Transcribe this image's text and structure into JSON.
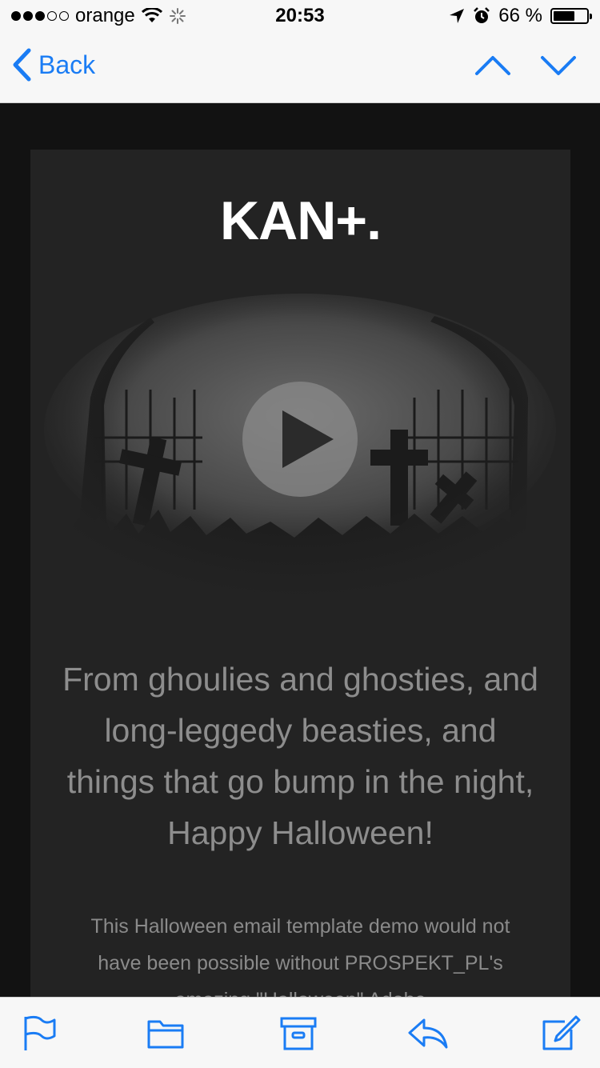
{
  "status_bar": {
    "carrier": "orange",
    "time": "20:53",
    "battery_percent": "66 %",
    "battery_level": 0.66
  },
  "nav": {
    "back_label": "Back"
  },
  "email": {
    "logo_text": "KAN+.",
    "headline": "From ghoulies and ghosties, and long-leggedy beasties, and things that go bump in the night, Happy Halloween!",
    "body": "This Halloween email template demo would not have been possible without PROSPEKT_PL's amazing \"Halloween\" Adobe"
  },
  "icons": {
    "signal": "signal-dots-icon",
    "wifi": "wifi-icon",
    "activity": "activity-spinner-icon",
    "location": "location-arrow-icon",
    "alarm": "alarm-clock-icon",
    "battery": "battery-icon",
    "back": "chevron-left-icon",
    "prev": "chevron-up-icon",
    "next": "chevron-down-icon",
    "play": "play-icon",
    "flag": "flag-icon",
    "folder": "folder-icon",
    "archive": "archive-icon",
    "reply": "reply-icon",
    "compose": "compose-icon"
  },
  "colors": {
    "accent": "#1a7cf4",
    "email_background": "#232323",
    "page_background": "#121212"
  }
}
